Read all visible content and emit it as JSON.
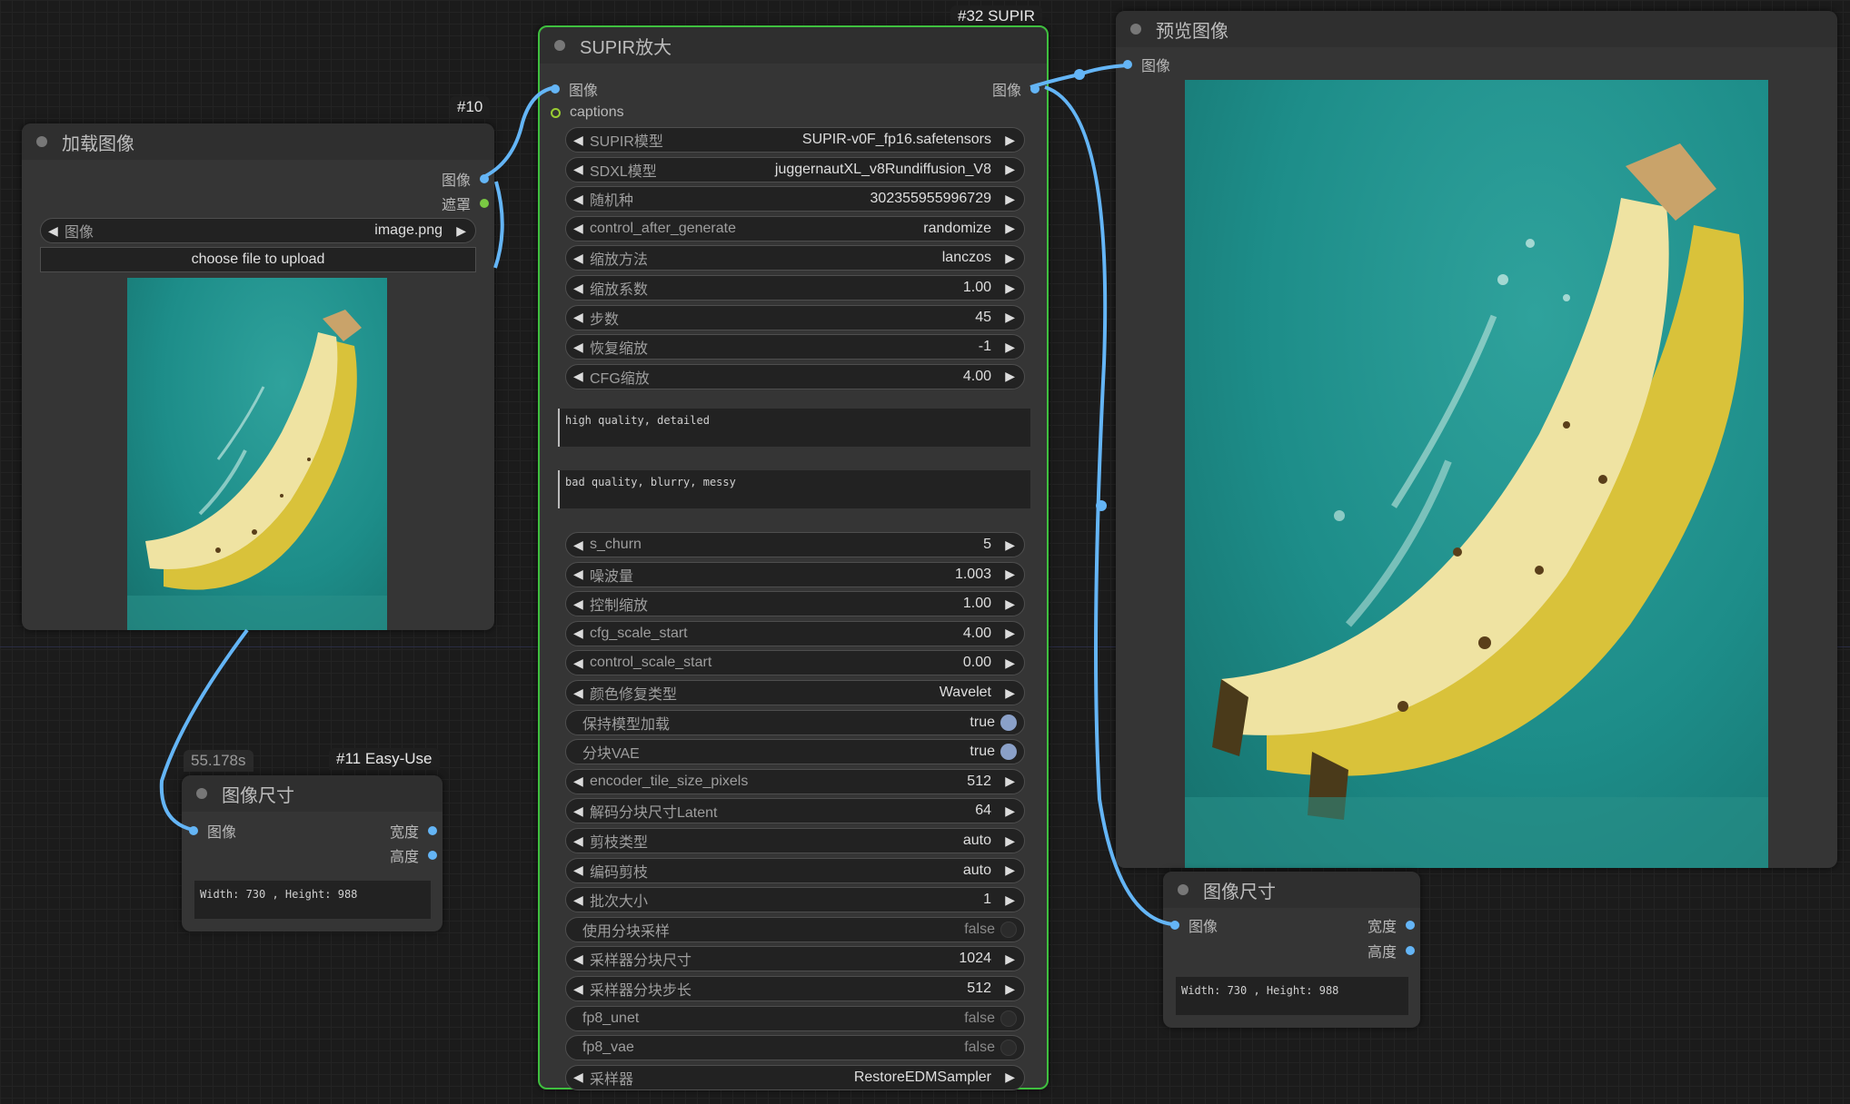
{
  "load_node": {
    "title": "加载图像",
    "badge": "#10",
    "out_image": "图像",
    "out_mask": "遮罩",
    "image_label": "图像",
    "image_value": "image.png",
    "upload_label": "choose file to upload"
  },
  "size_node_small": {
    "timing": "55.178s",
    "badge": "#11 Easy-Use",
    "title": "图像尺寸",
    "in_image": "图像",
    "out_width": "宽度",
    "out_height": "高度",
    "readout": "Width: 730 , Height: 988"
  },
  "supir_node": {
    "title": "SUPIR放大",
    "badge": "#32 SUPIR",
    "in_image": "图像",
    "in_captions": "captions",
    "out_image": "图像",
    "widgets_top": [
      {
        "label": "SUPIR模型",
        "value": "SUPIR-v0F_fp16.safetensors"
      },
      {
        "label": "SDXL模型",
        "value": "juggernautXL_v8Rundiffusion_V8"
      },
      {
        "label": "随机种",
        "value": "302355955996729"
      },
      {
        "label": "control_after_generate",
        "value": "randomize"
      },
      {
        "label": "缩放方法",
        "value": "lanczos"
      },
      {
        "label": "缩放系数",
        "value": "1.00"
      },
      {
        "label": "步数",
        "value": "45"
      },
      {
        "label": "恢复缩放",
        "value": "-1"
      },
      {
        "label": "CFG缩放",
        "value": "4.00"
      }
    ],
    "positive_prompt": "high quality, detailed",
    "negative_prompt": "bad quality, blurry, messy",
    "widgets_bottom": [
      {
        "label": "s_churn",
        "value": "5",
        "kind": "num"
      },
      {
        "label": "噪波量",
        "value": "1.003",
        "kind": "num"
      },
      {
        "label": "控制缩放",
        "value": "1.00",
        "kind": "num"
      },
      {
        "label": "cfg_scale_start",
        "value": "4.00",
        "kind": "num"
      },
      {
        "label": "control_scale_start",
        "value": "0.00",
        "kind": "num"
      },
      {
        "label": "颜色修复类型",
        "value": "Wavelet",
        "kind": "num"
      },
      {
        "label": "保持模型加载",
        "value": "true",
        "kind": "toggle_on"
      },
      {
        "label": "分块VAE",
        "value": "true",
        "kind": "toggle_on"
      },
      {
        "label": "encoder_tile_size_pixels",
        "value": "512",
        "kind": "num"
      },
      {
        "label": "解码分块尺寸Latent",
        "value": "64",
        "kind": "num"
      },
      {
        "label": "剪枝类型",
        "value": "auto",
        "kind": "num"
      },
      {
        "label": "编码剪枝",
        "value": "auto",
        "kind": "num"
      },
      {
        "label": "批次大小",
        "value": "1",
        "kind": "num"
      },
      {
        "label": "使用分块采样",
        "value": "false",
        "kind": "toggle_off"
      },
      {
        "label": "采样器分块尺寸",
        "value": "1024",
        "kind": "num"
      },
      {
        "label": "采样器分块步长",
        "value": "512",
        "kind": "num"
      },
      {
        "label": "fp8_unet",
        "value": "false",
        "kind": "toggle_off"
      },
      {
        "label": "fp8_vae",
        "value": "false",
        "kind": "toggle_off"
      },
      {
        "label": "采样器",
        "value": "RestoreEDMSampler",
        "kind": "num"
      }
    ]
  },
  "preview_node": {
    "title": "预览图像",
    "in_image": "图像"
  },
  "size_node_right": {
    "title": "图像尺寸",
    "in_image": "图像",
    "out_width": "宽度",
    "out_height": "高度",
    "readout": "Width: 730 , Height: 988"
  },
  "colors": {
    "link": "#64b5f6",
    "selected_border": "#3fbf3f",
    "canvas": "#1b1b1b",
    "node_body": "#353535"
  },
  "arrows": {
    "left": "◀",
    "right": "▶"
  }
}
